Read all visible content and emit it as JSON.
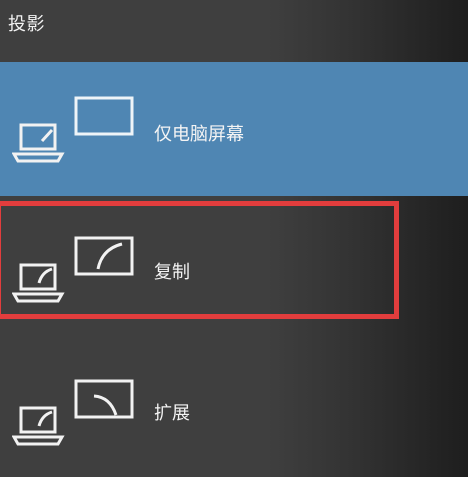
{
  "panel": {
    "title": "投影"
  },
  "options": [
    {
      "label": "仅电脑屏幕",
      "icon": "pc-screen-only-icon",
      "selected": true
    },
    {
      "label": "复制",
      "icon": "duplicate-display-icon",
      "selected": false
    },
    {
      "label": "扩展",
      "icon": "extend-display-icon",
      "selected": false
    }
  ],
  "colors": {
    "background": "#3f3f3f",
    "selected": "#4f86b3",
    "highlight": "#e23d3d",
    "text": "#f4f4f4"
  }
}
